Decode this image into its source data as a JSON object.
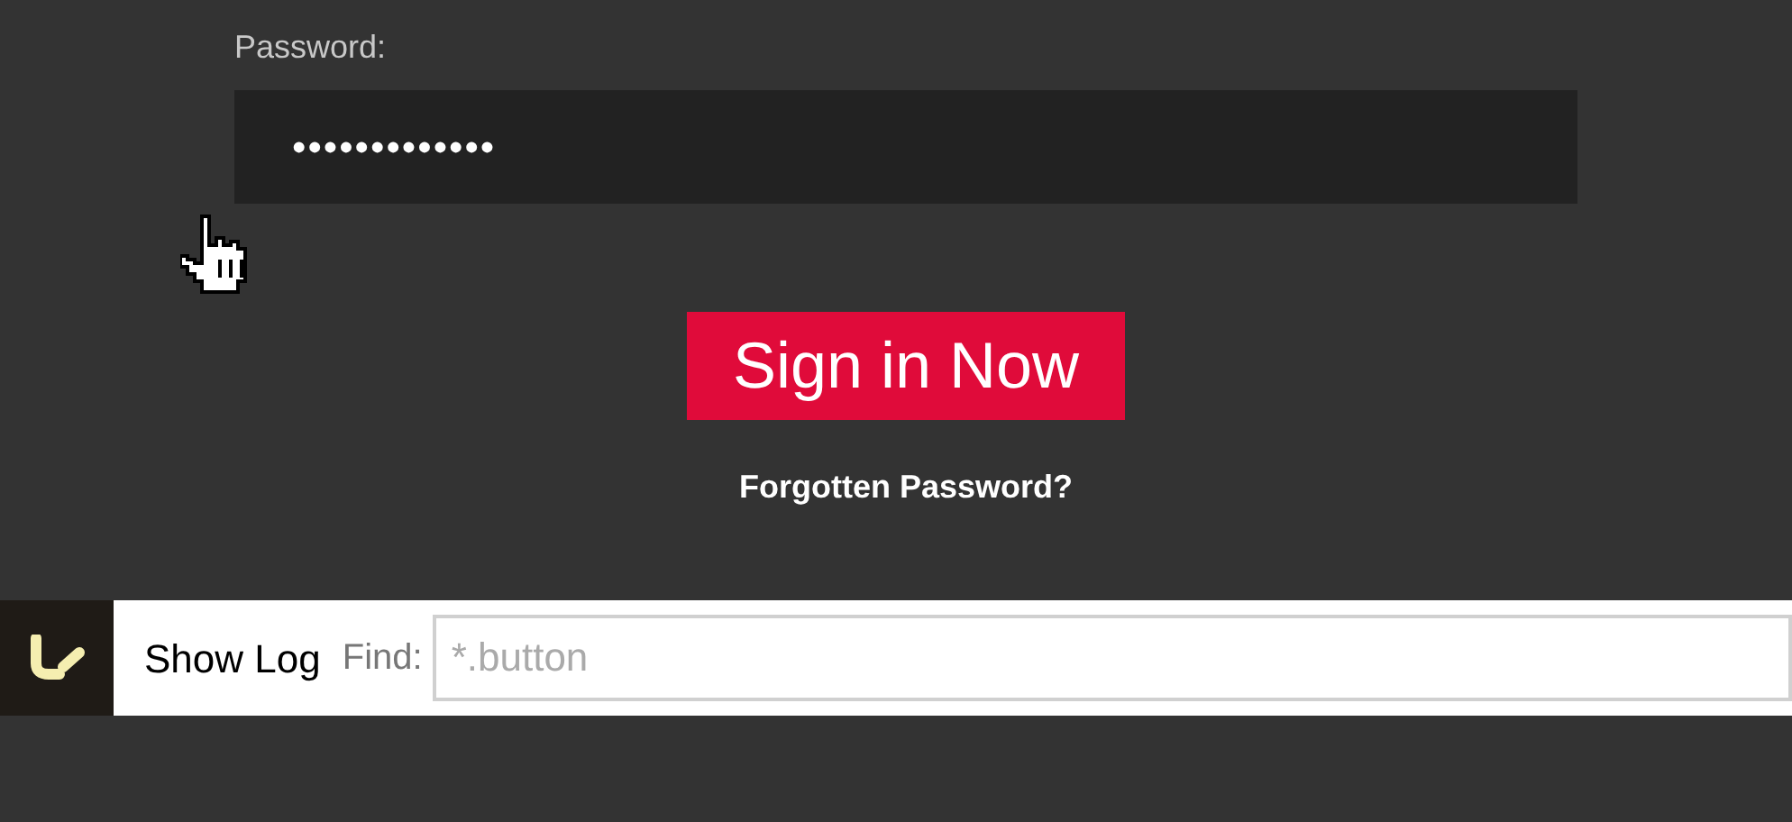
{
  "login": {
    "password_label": "Password:",
    "password_value": "•••••••••••••",
    "submit_button": "Sign in Now",
    "forgot_link": "Forgotten Password?"
  },
  "toolbar": {
    "show_log_button": "Show Log",
    "find_label": "Find:",
    "find_placeholder": "*.button"
  }
}
